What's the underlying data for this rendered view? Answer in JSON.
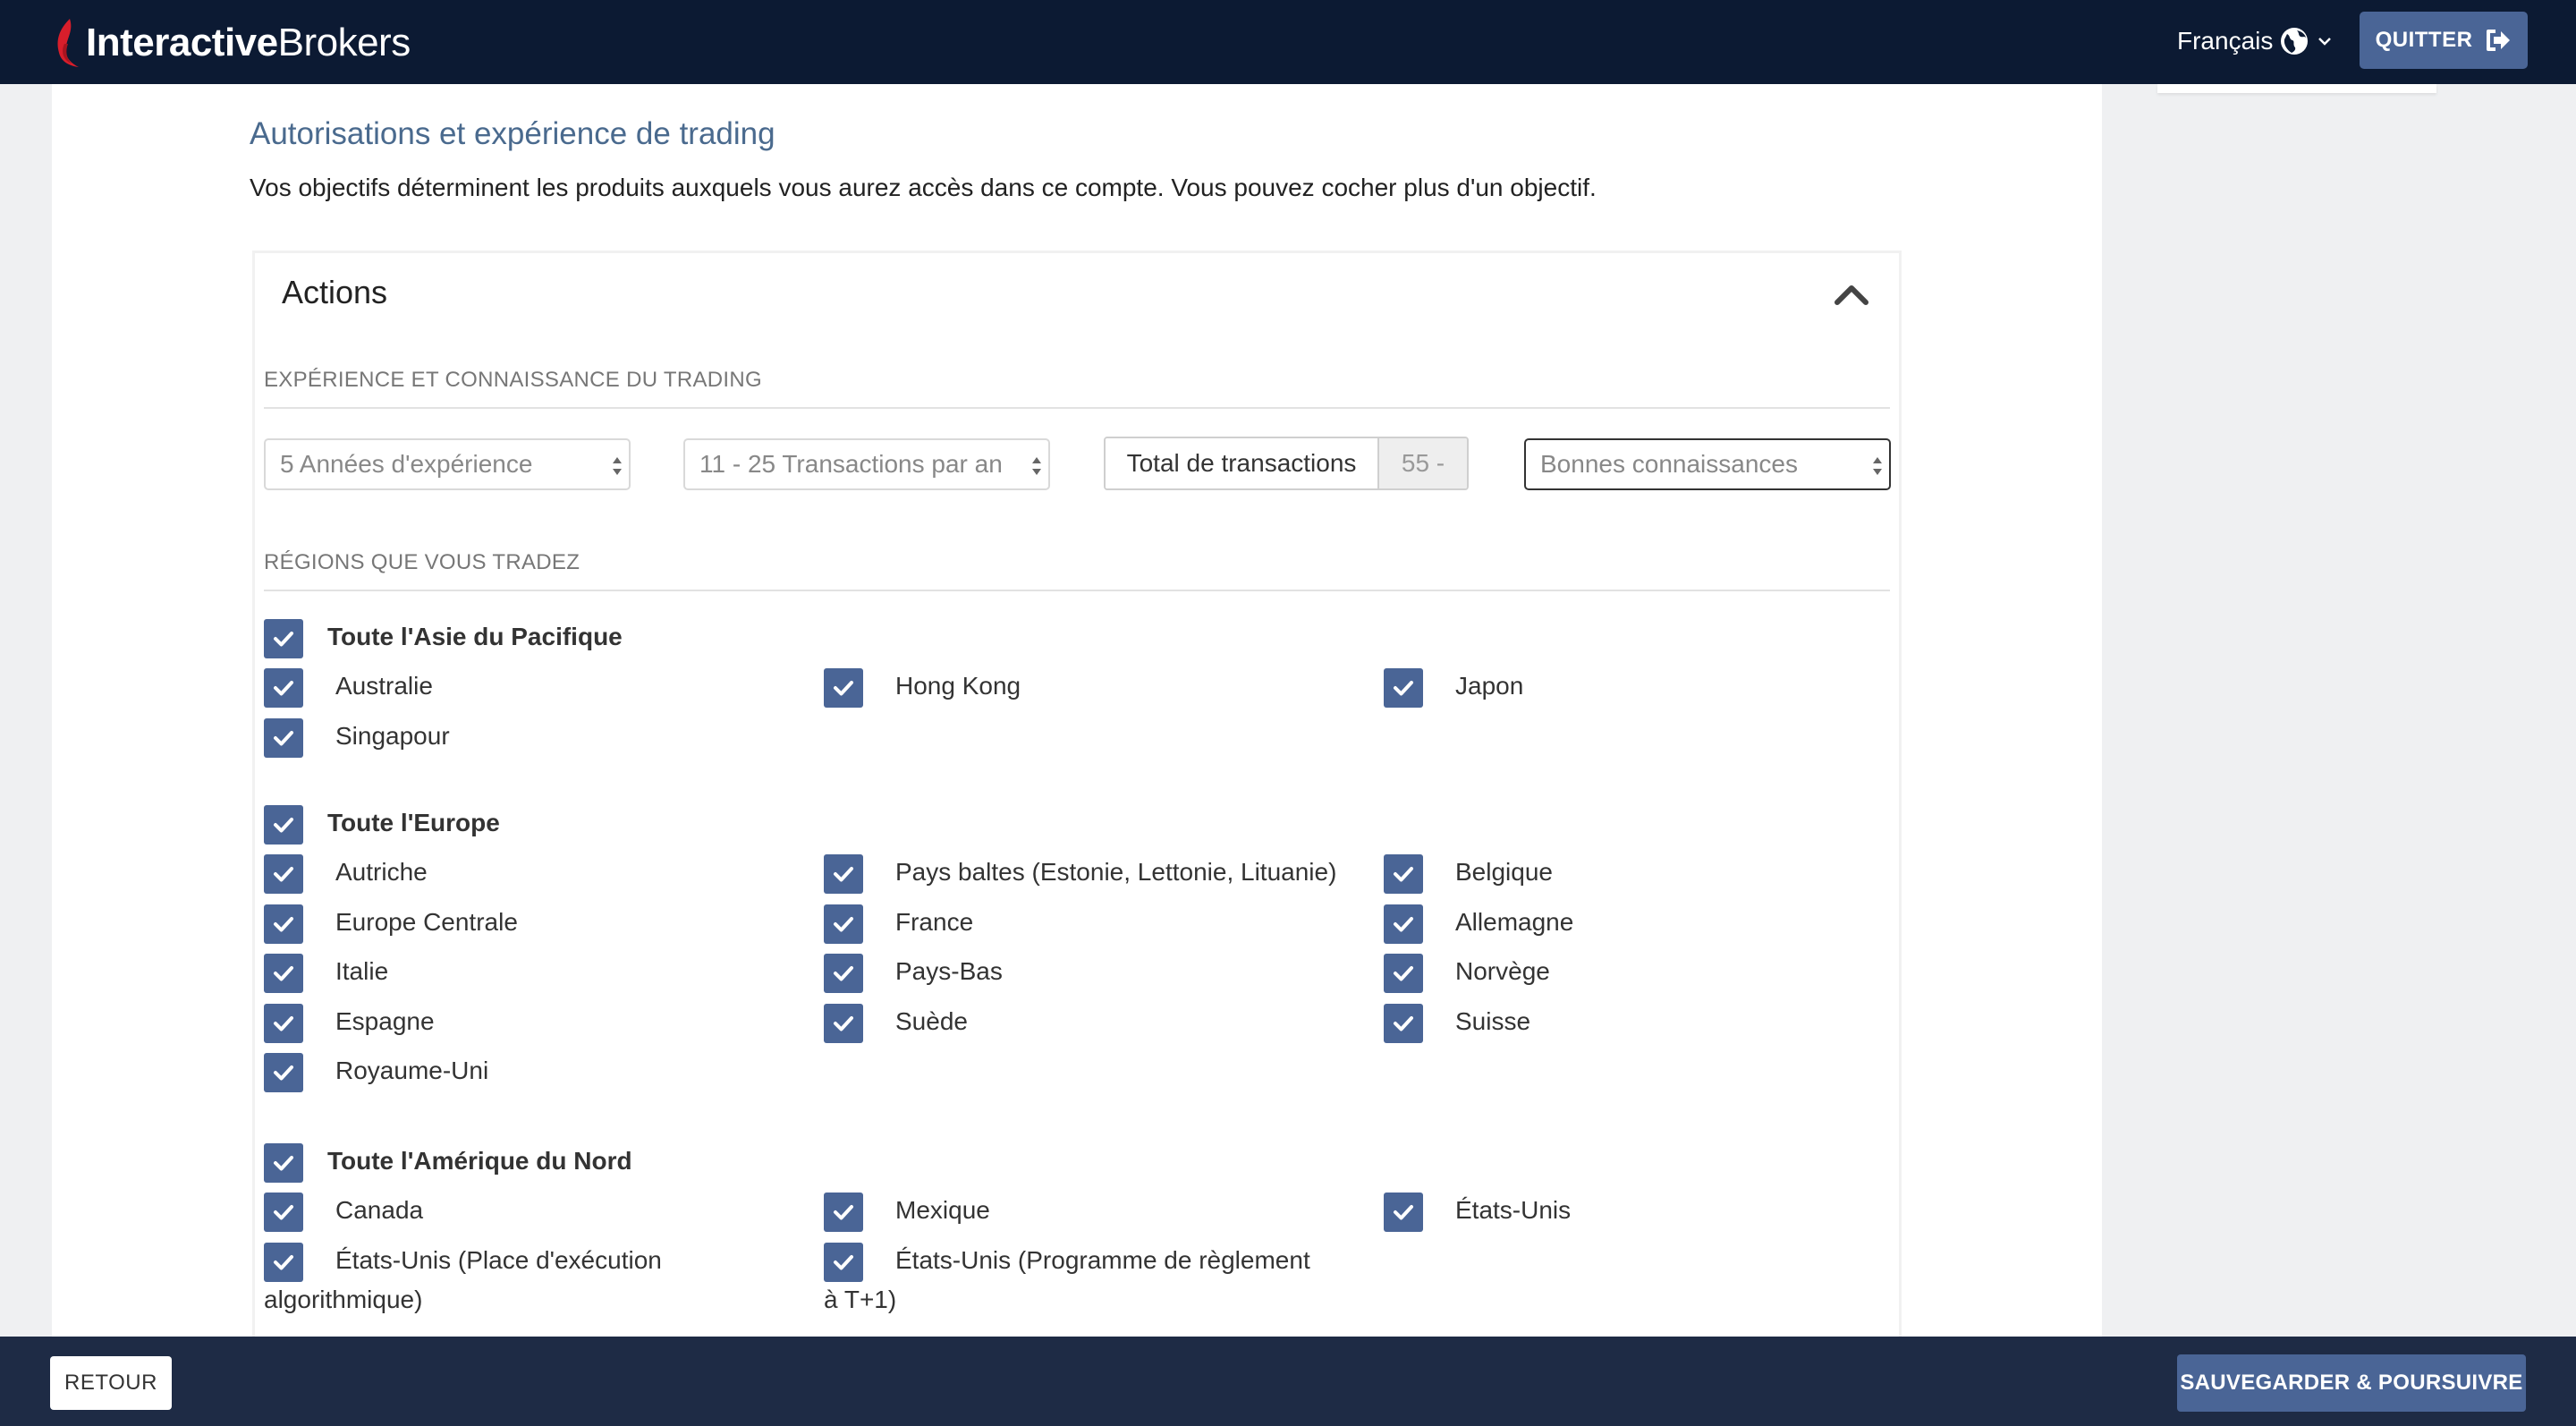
{
  "header": {
    "logo_bold": "Interactive",
    "logo_light": "Brokers",
    "language": "Français",
    "quit_label": "QUITTER"
  },
  "page": {
    "heading": "Autorisations et expérience de trading",
    "intro": "Vos objectifs déterminent les produits auxquels vous aurez accès dans ce compte. Vous pouvez cocher plus d'un objectif."
  },
  "card": {
    "title": "Actions",
    "experience_section": "EXPÉRIENCE ET CONNAISSANCE DU TRADING",
    "years_select": "5 Années d'expérience",
    "transactions_select": "11 - 25 Transactions par an",
    "total_label": "Total de transactions",
    "total_value": "55 -",
    "knowledge_select": "Bonnes connaissances",
    "regions_section": "RÉGIONS QUE VOUS TRADEZ"
  },
  "regions": {
    "asia": {
      "title": "Toute l'Asie du Pacifique",
      "items": [
        "Australie",
        "Hong Kong",
        "Japon",
        "Singapour"
      ]
    },
    "europe": {
      "title": "Toute l'Europe",
      "items": [
        "Autriche",
        "Pays baltes (Estonie, Lettonie, Lituanie)",
        "Belgique",
        "Europe Centrale",
        "France",
        "Allemagne",
        "Italie",
        "Pays-Bas",
        "Norvège",
        "Espagne",
        "Suède",
        "Suisse",
        "Royaume-Uni"
      ]
    },
    "north_america": {
      "title": "Toute l'Amérique du Nord",
      "items": [
        "Canada",
        "Mexique",
        "États-Unis",
        "États-Unis (Place d'exécution algorithmique)",
        "États-Unis (Programme de règlement à T+1)"
      ]
    }
  },
  "footer": {
    "back_label": "RETOUR",
    "save_label": "SAUVEGARDER & POURSUIVRE"
  },
  "colors": {
    "topbar": "#0c1a33",
    "accent": "#4a6596",
    "heading": "#4a6a8e",
    "footer": "#1e2b45"
  },
  "icons": [
    "logo-flame-icon",
    "globe-icon",
    "chevron-down-icon",
    "sign-out-icon",
    "chevron-up-icon",
    "checkmark-icon",
    "select-arrows-icon"
  ]
}
